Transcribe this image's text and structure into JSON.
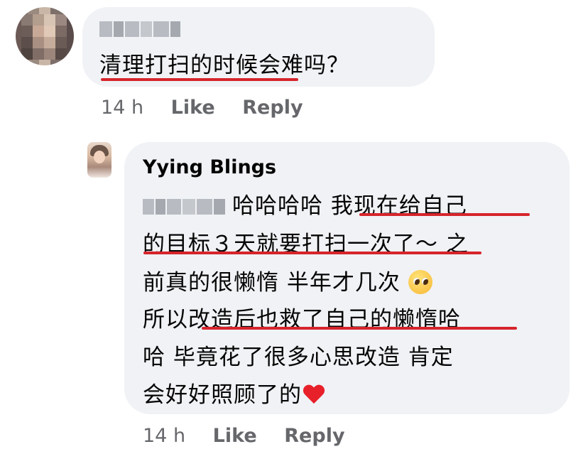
{
  "comment": {
    "author_name_obscured": "",
    "text": "清理打扫的时候会难吗？",
    "time": "14 h",
    "like_label": "Like",
    "reply_label": "Reply"
  },
  "reply": {
    "author": "Yying Blings",
    "line1_prefix": "哈哈哈哈 ",
    "line1_highlight": "我现在给自己",
    "line2_highlight": "的目标３天就要打扫一次了",
    "line2_suffix": "～ 之",
    "line3": "前真的很懒惰 半年才几次",
    "line4_prefix": "所以",
    "line4_highlight": "改造后也救了自己的懒惰",
    "line4_suffix": "哈",
    "line5": "哈 毕竟花了很多心思改造 肯定",
    "line6": "会好好照顾了的",
    "time": "14 h",
    "like_label": "Like",
    "reply_label": "Reply"
  },
  "icons": {
    "pleading": "pleading-face-emoji",
    "heart": "red-heart-emoji"
  },
  "colors": {
    "bubble_bg": "#f0f2f5",
    "meta_text": "#65676b",
    "underline_red": "#d6252c"
  }
}
